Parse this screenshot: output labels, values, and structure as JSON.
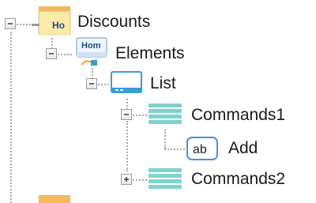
{
  "tree": {
    "nodes": [
      {
        "id": "discounts",
        "label": "Discounts",
        "icon": "record-table-icon",
        "expanded": true
      },
      {
        "id": "elements",
        "label": "Elements",
        "icon": "form-elements-icon",
        "expanded": true
      },
      {
        "id": "list",
        "label": "List",
        "icon": "list-window-icon",
        "expanded": true
      },
      {
        "id": "commands1",
        "label": "Commands1",
        "icon": "command-list-icon",
        "expanded": true
      },
      {
        "id": "add",
        "label": "Add",
        "icon": "ab-button-icon"
      },
      {
        "id": "commands2",
        "label": "Commands2",
        "icon": "command-list-icon",
        "expanded": false
      }
    ],
    "discounts_icon_text": "Ho",
    "elements_icon_text": "Hom",
    "add_icon_text": "ab"
  },
  "colors": {
    "connector": "#a8a8a8",
    "accent_orange": "#f6b85a",
    "list_icon_blue": "#3a9bd6",
    "command_icon_teal": "#7fd3cf",
    "add_icon_border": "#4a90d9"
  }
}
